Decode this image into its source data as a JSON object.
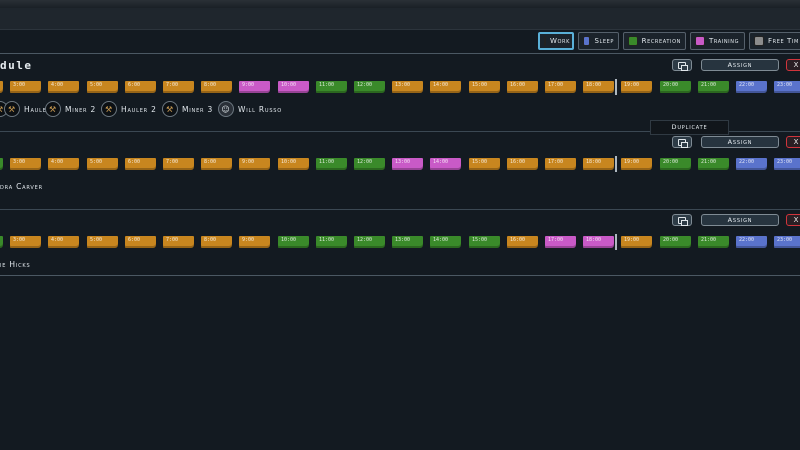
{
  "colors": {
    "work": "#c8861f",
    "sleep": "#5a73cc",
    "recreation": "#3a8a2a",
    "training": "#c95ac7",
    "free_time": "#8c8c8c"
  },
  "legend": [
    {
      "key": "work",
      "label": "Work",
      "active": true
    },
    {
      "key": "sleep",
      "label": "Sleep",
      "active": false
    },
    {
      "key": "recreation",
      "label": "Recreation",
      "active": false
    },
    {
      "key": "training",
      "label": "Training",
      "active": false
    },
    {
      "key": "free_time",
      "label": "Free Tim",
      "active": false
    }
  ],
  "hours": [
    "",
    "3:00",
    "4:00",
    "5:00",
    "6:00",
    "7:00",
    "8:00",
    "9:00",
    "10:00",
    "11:00",
    "12:00",
    "13:00",
    "14:00",
    "15:00",
    "16:00",
    "17:00",
    "18:00",
    "19:00",
    "20:00",
    "21:00",
    "22:00",
    "23:00"
  ],
  "assign_label": "Assign",
  "delete_label": "X",
  "tooltip": "Duplicate",
  "schedules": [
    {
      "name": "dule",
      "blocks": [
        "work",
        "work",
        "work",
        "work",
        "work",
        "work",
        "work",
        "training",
        "training",
        "recreation",
        "recreation",
        "work",
        "work",
        "work",
        "work",
        "work",
        "work",
        "work",
        "recreation",
        "recreation",
        "sleep",
        "sleep"
      ],
      "members": [
        {
          "name": "",
          "icon": "hauler-icon",
          "glyph": "⚒"
        },
        {
          "name": "Hauler",
          "icon": "hauler-icon",
          "glyph": "⚒"
        },
        {
          "name": "Miner 2",
          "icon": "miner-icon",
          "glyph": "⚒"
        },
        {
          "name": "Hauler 2",
          "icon": "hauler-icon",
          "glyph": "⚒"
        },
        {
          "name": "Miner 3",
          "icon": "miner-icon",
          "glyph": "⚒"
        },
        {
          "name": "Will Russo",
          "icon": "portrait-icon",
          "glyph": "☺"
        }
      ]
    },
    {
      "name": "",
      "blocks": [
        "recreation",
        "work",
        "work",
        "work",
        "work",
        "work",
        "work",
        "work",
        "work",
        "recreation",
        "recreation",
        "training",
        "training",
        "work",
        "work",
        "work",
        "work",
        "work",
        "recreation",
        "recreation",
        "sleep",
        "sleep"
      ],
      "members_text": "dra Carver"
    },
    {
      "name": "",
      "blocks": [
        "recreation",
        "work",
        "work",
        "work",
        "work",
        "work",
        "work",
        "work",
        "recreation",
        "recreation",
        "recreation",
        "recreation",
        "recreation",
        "recreation",
        "work",
        "training",
        "training",
        "work",
        "recreation",
        "recreation",
        "sleep",
        "sleep"
      ],
      "members_text": "ie Hicks"
    }
  ]
}
